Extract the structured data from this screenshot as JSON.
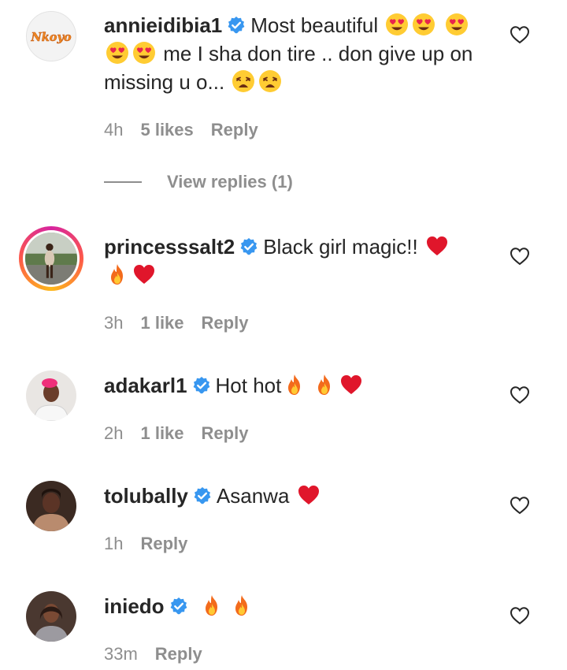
{
  "comments": [
    {
      "username": "annieidibia1",
      "text_1": "Most beautiful",
      "text_2": "me I sha don tire .. don give up on missing u o...",
      "time": "4h",
      "likes": "5 likes",
      "reply": "Reply",
      "view_replies": "View replies (1)",
      "avatar_logo_text": "Nkoyo"
    },
    {
      "username": "princesssalt2",
      "text": "Black girl magic!!",
      "time": "3h",
      "likes": "1 like",
      "reply": "Reply"
    },
    {
      "username": "adakarl1",
      "text": "Hot hot",
      "time": "2h",
      "likes": "1 like",
      "reply": "Reply"
    },
    {
      "username": "tolubally",
      "text": "Asanwa",
      "time": "1h",
      "reply": "Reply"
    },
    {
      "username": "iniedo",
      "text": "",
      "time": "33m",
      "reply": "Reply"
    }
  ],
  "colors": {
    "text": "#262626",
    "meta": "#8e8e8e",
    "verified": "#3897f0",
    "heart_emoji": "#e0162b"
  },
  "icons": [
    "verified-badge-icon",
    "heart-outline-icon",
    "heart-eyes-emoji",
    "weary-face-emoji",
    "fire-emoji",
    "red-heart-emoji"
  ]
}
